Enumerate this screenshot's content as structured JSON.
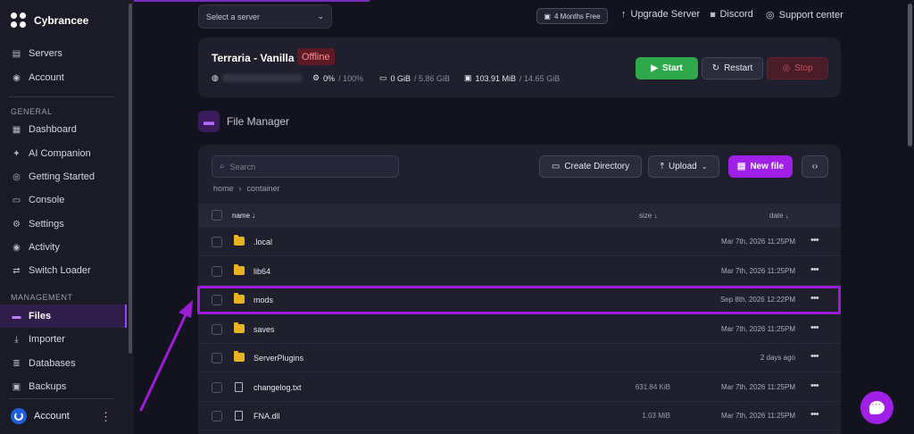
{
  "sidebar": {
    "brand": "Cybrancee",
    "top_items": [
      {
        "label": "Servers",
        "icon": "server-icon"
      },
      {
        "label": "Account",
        "icon": "user-circle-icon"
      }
    ],
    "general_label": "GENERAL",
    "general_items": [
      {
        "label": "Dashboard",
        "icon": "dashboard-icon"
      },
      {
        "label": "AI Companion",
        "icon": "ai-chat-icon"
      },
      {
        "label": "Getting Started",
        "icon": "help-icon"
      },
      {
        "label": "Console",
        "icon": "terminal-icon"
      },
      {
        "label": "Settings",
        "icon": "gear-icon"
      },
      {
        "label": "Activity",
        "icon": "eye-icon"
      },
      {
        "label": "Switch Loader",
        "icon": "swap-icon"
      }
    ],
    "management_label": "MANAGEMENT",
    "management_items": [
      {
        "label": "Files",
        "icon": "folder-icon",
        "active": true
      },
      {
        "label": "Importer",
        "icon": "download-icon"
      },
      {
        "label": "Databases",
        "icon": "database-icon"
      },
      {
        "label": "Backups",
        "icon": "archive-icon"
      }
    ],
    "account_label": "Account"
  },
  "topbar": {
    "server_select_placeholder": "Select a server",
    "free_pill": "4 Months Free",
    "upgrade": "Upgrade Server",
    "discord": "Discord",
    "support": "Support center"
  },
  "server": {
    "name": "Terraria - Vanilla",
    "status": "Offline",
    "cpu": "0%",
    "cpu_limit": "/ 100%",
    "memory": "0 GiB",
    "memory_limit": "/ 5.86 GiB",
    "disk": "103.91 MiB",
    "disk_limit": "/ 14.65 GiB",
    "start_label": "Start",
    "restart_label": "Restart",
    "stop_label": "Stop",
    "accent_start": "#2ea84a",
    "accent_stop": "#c9505e"
  },
  "file_manager": {
    "title": "File Manager",
    "search_placeholder": "Search",
    "breadcrumb": [
      "home",
      "container"
    ],
    "create_directory_label": "Create Directory",
    "upload_label": "Upload",
    "new_file_label": "New file",
    "columns": {
      "name": "name ↓",
      "size": "size ↓",
      "date": "date ↓"
    },
    "rows": [
      {
        "name": ".local",
        "type": "folder",
        "size": "",
        "date": "Mar 7th, 2026 11:25PM"
      },
      {
        "name": "lib64",
        "type": "folder",
        "size": "",
        "date": "Mar 7th, 2026 11:25PM"
      },
      {
        "name": "mods",
        "type": "folder",
        "size": "",
        "date": "Sep 8th, 2026 12:22PM",
        "highlighted": true
      },
      {
        "name": "saves",
        "type": "folder",
        "size": "",
        "date": "Mar 7th, 2026 11:25PM"
      },
      {
        "name": "ServerPlugins",
        "type": "folder",
        "size": "",
        "date": "2 days ago"
      },
      {
        "name": "changelog.txt",
        "type": "file",
        "size": "631.84 KiB",
        "date": "Mar 7th, 2026 11:25PM"
      },
      {
        "name": "FNA.dll",
        "type": "file",
        "size": "1.03 MiB",
        "date": "Mar 7th, 2026 11:25PM"
      }
    ],
    "accent": "#a020e8"
  }
}
